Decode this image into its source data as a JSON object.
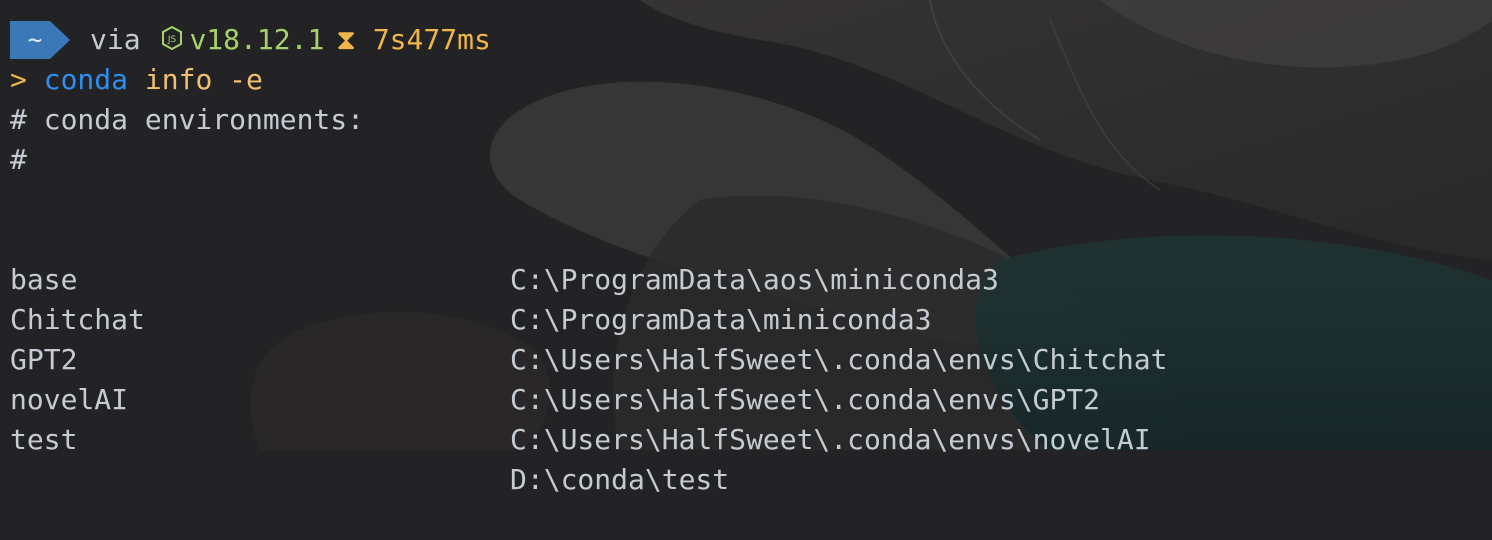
{
  "prompt": {
    "directory": "~",
    "via_label": "via",
    "node_icon": "nodejs-icon",
    "node_version": "v18.12.1",
    "timer_icon": "hourglass-icon",
    "duration": "7s477ms"
  },
  "command_line": {
    "prompt_char": ">",
    "command": "conda",
    "args": "info -e"
  },
  "output": {
    "header": "# conda environments:",
    "header_hash": "#",
    "environments": [
      {
        "name": "",
        "path": "C:\\ProgramData\\aos\\miniconda3"
      },
      {
        "name": "base",
        "path": "C:\\ProgramData\\miniconda3"
      },
      {
        "name": "Chitchat",
        "path": "C:\\Users\\HalfSweet\\.conda\\envs\\Chitchat"
      },
      {
        "name": "GPT2",
        "path": "C:\\Users\\HalfSweet\\.conda\\envs\\GPT2"
      },
      {
        "name": "novelAI",
        "path": "C:\\Users\\HalfSweet\\.conda\\envs\\novelAI"
      },
      {
        "name": "test",
        "path": "D:\\conda\\test"
      }
    ]
  },
  "colors": {
    "background": "#232325",
    "text": "#c5cbd3",
    "node_green": "#a6d26b",
    "duration_yellow": "#f0b64a",
    "command_blue": "#2e8ef0",
    "args_yellow": "#f0c070",
    "segment_blue": "#3a78b8"
  }
}
